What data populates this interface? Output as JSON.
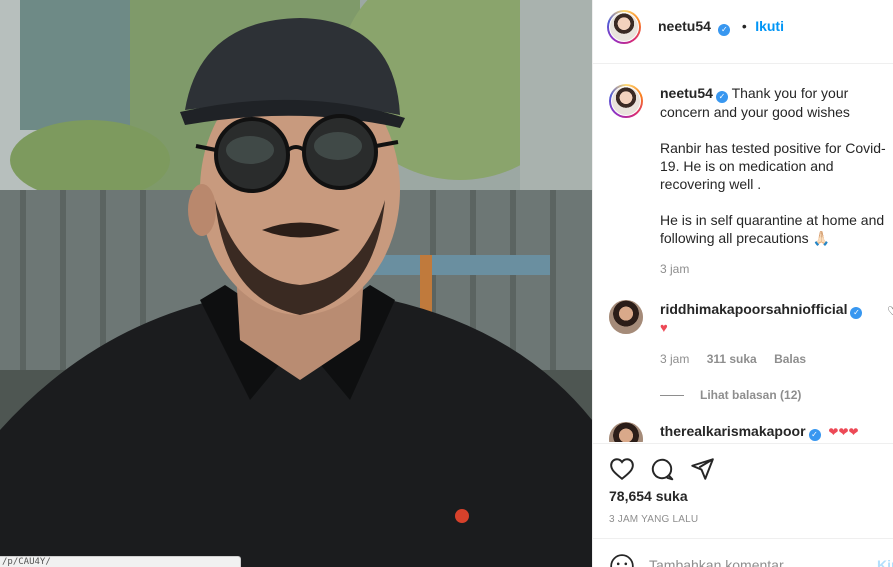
{
  "post": {
    "username": "neetu54",
    "follow_label": "Ikuti",
    "dot": "•",
    "verified_glyph": "✓"
  },
  "caption": {
    "username": "neetu54",
    "text": "Thank you for your concern and your good wishes\n\nRanbir has tested positive for Covid-19. He is on medication and recovering well .\n\nHe is in self quarantine at home and following all precautions 🙏🏻",
    "time": "3 jam"
  },
  "comments": [
    {
      "username": "riddhimakapoorsahniofficial",
      "text": "♥",
      "time": "3 jam",
      "likes": "311 suka",
      "reply_label": "Balas",
      "view_replies": "Lihat balasan (12)"
    },
    {
      "username": "therealkarismakapoor",
      "text": "❤❤❤"
    }
  ],
  "stats": {
    "likes": "78,654 suka",
    "time_ago": "3 JAM YANG LALU"
  },
  "add_comment": {
    "placeholder": "Tambahkan komentar...",
    "post_label": "Kirim"
  },
  "status_url": "/p/CAU4Y/",
  "icons": {
    "like": "heart-icon",
    "comment": "comment-icon",
    "share": "paper-plane-icon",
    "save": "bookmark-icon",
    "emoji": "emoji-icon"
  },
  "colors": {
    "accent": "#0095f6",
    "verified": "#3897f0",
    "heart_red": "#ed4956"
  }
}
